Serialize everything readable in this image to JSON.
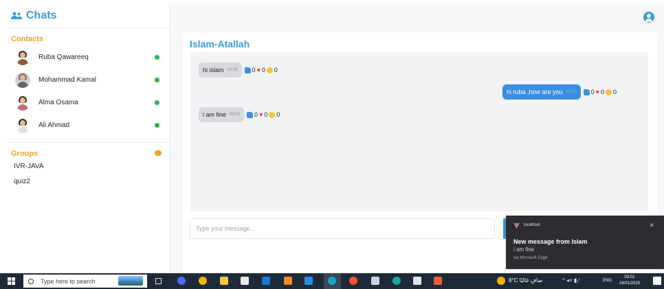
{
  "app": {
    "title": "Chats"
  },
  "sidebar": {
    "contacts_title": "Contacts",
    "contacts": [
      {
        "name": "Ruba Qawareeq",
        "status": "online"
      },
      {
        "name": "Mohammad Kamal",
        "status": "online"
      },
      {
        "name": "Alma Osama",
        "status": "online"
      },
      {
        "name": "Ali Ahmad",
        "status": "online"
      }
    ],
    "groups_title": "Groups",
    "groups": [
      "IVR-JAVA",
      "quiz2"
    ]
  },
  "chat": {
    "title": "Islam-Atallah",
    "messages": [
      {
        "text": "hi islam",
        "time": "02:58",
        "direction": "in",
        "likes": "0",
        "hearts": "0",
        "laughs": "0"
      },
      {
        "text": "hi ruba ,how are you",
        "time": "03:00",
        "direction": "out",
        "likes": "0",
        "hearts": "0",
        "laughs": "0"
      },
      {
        "text": "i am fine",
        "time": "03:00",
        "direction": "in",
        "likes": "0",
        "hearts": "0",
        "laughs": "0"
      }
    ],
    "composer_placeholder": "Type your message..."
  },
  "toast": {
    "source": "localhost",
    "title": "New message from Islam",
    "body": "i am fine",
    "via": "via Microsoft Edge",
    "close": "✕"
  },
  "taskbar": {
    "search_placeholder": "Type here to search",
    "weather": "8°C صافٍ غالبًا",
    "lang": "ENG",
    "time": "03:01",
    "date": "24/01/2025",
    "notif_count": "17"
  },
  "colors": {
    "accent": "#3a9ad9",
    "orange": "#f0a425",
    "online": "#2ab34b",
    "out_bubble": "#3a8fe0"
  }
}
